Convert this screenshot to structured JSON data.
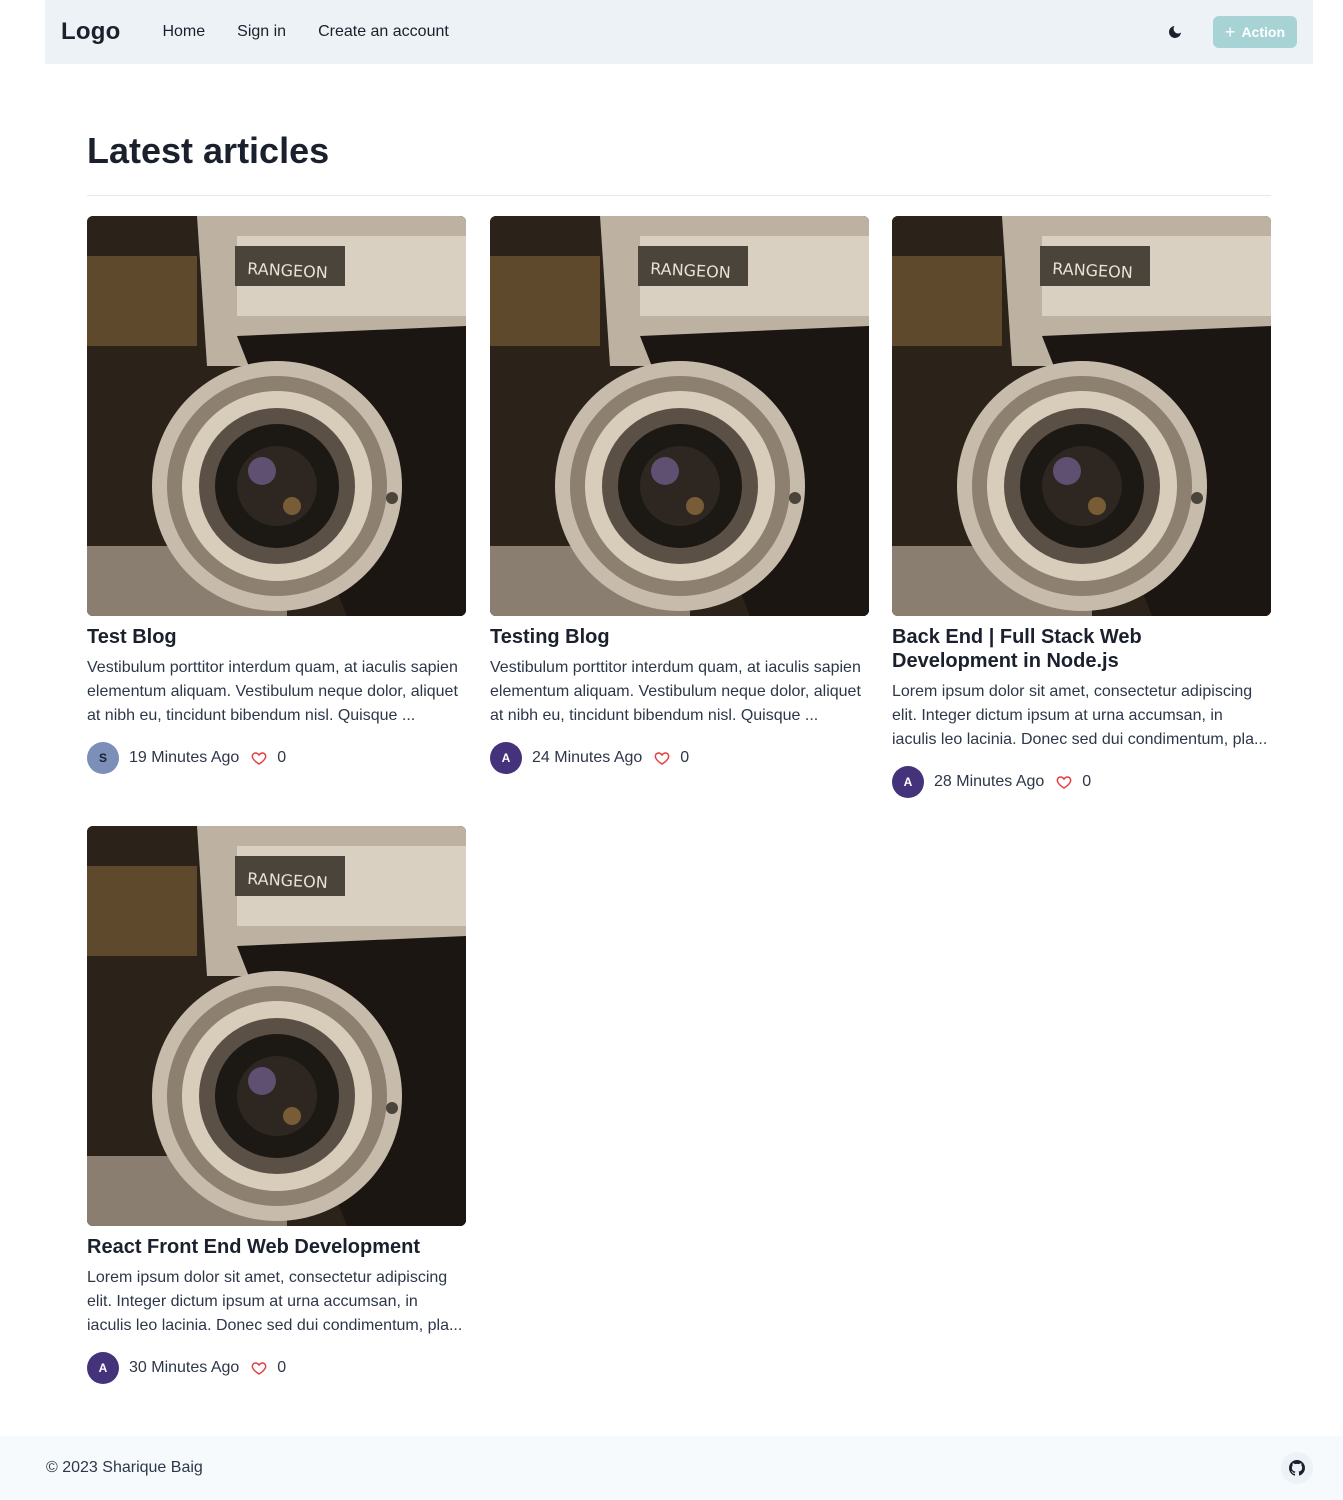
{
  "navbar": {
    "logo": "Logo",
    "links": [
      "Home",
      "Sign in",
      "Create an account"
    ],
    "action_label": "Action",
    "action_color": "#a7d3d5"
  },
  "main": {
    "title": "Latest articles"
  },
  "articles": [
    {
      "title": "Test Blog",
      "excerpt": "Vestibulum porttitor interdum quam, at iaculis sapien elementum aliquam. Vestibulum neque dolor, aliquet at nibh eu, tincidunt bibendum nisl. Quisque ...",
      "author_initial": "S",
      "time": "19 Minutes Ago",
      "likes": "0",
      "image": "camera-photo"
    },
    {
      "title": "Testing Blog",
      "excerpt": "Vestibulum porttitor interdum quam, at iaculis sapien elementum aliquam. Vestibulum neque dolor, aliquet at nibh eu, tincidunt bibendum nisl. Quisque ...",
      "author_initial": "A",
      "time": "24 Minutes Ago",
      "likes": "0",
      "image": "camera-photo"
    },
    {
      "title": "Back End | Full Stack Web Development in Node.js",
      "excerpt": "Lorem ipsum dolor sit amet, consectetur adipiscing elit. Integer dictum ipsum at urna accumsan, in iaculis leo lacinia. Donec sed dui condimentum, pla...",
      "author_initial": "A",
      "time": "28 Minutes Ago",
      "likes": "0",
      "image": "camera-photo"
    },
    {
      "title": "React Front End Web Development",
      "excerpt": "Lorem ipsum dolor sit amet, consectetur adipiscing elit. Integer dictum ipsum at urna accumsan, in iaculis leo lacinia. Donec sed dui condimentum, pla...",
      "author_initial": "A",
      "time": "30 Minutes Ago",
      "likes": "0",
      "image": "camera-photo"
    }
  ],
  "footer": {
    "copyright": "© 2023 Sharique Baig",
    "icon": "github-icon"
  },
  "colors": {
    "avatar_s": "#7b8fb8",
    "avatar_a": "#44337a",
    "heart": "#e53e3e"
  }
}
